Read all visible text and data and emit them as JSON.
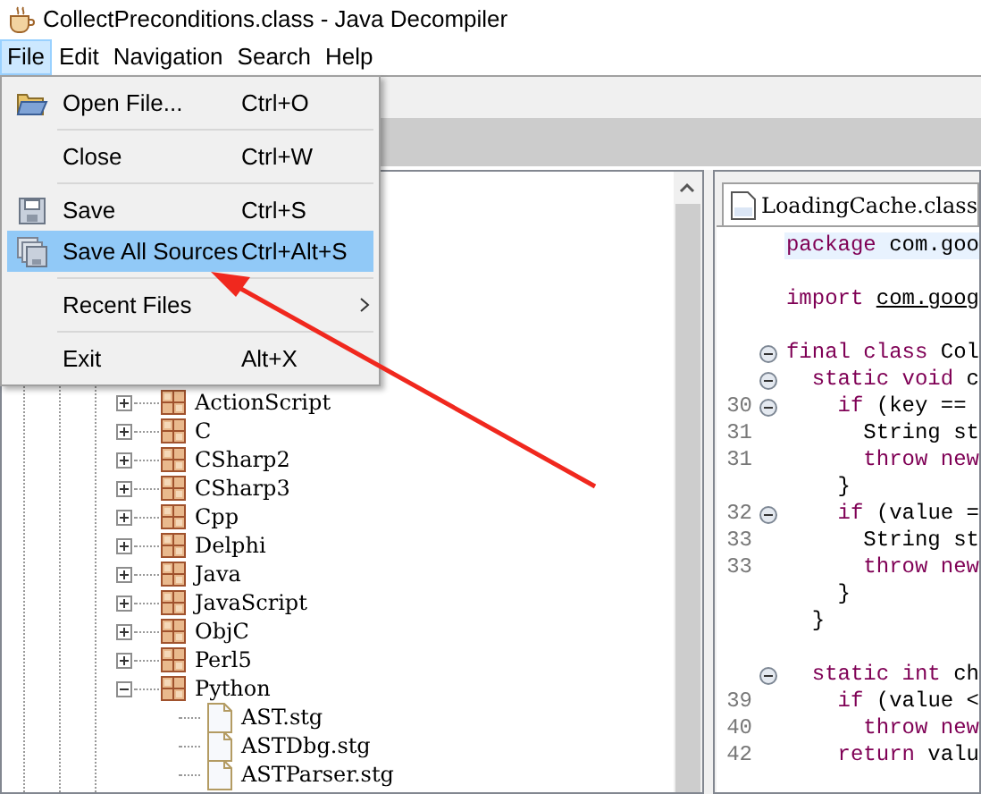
{
  "window": {
    "title": "CollectPreconditions.class - Java Decompiler"
  },
  "menubar": [
    {
      "label": "File",
      "selected": true
    },
    {
      "label": "Edit",
      "selected": false
    },
    {
      "label": "Navigation",
      "selected": false
    },
    {
      "label": "Search",
      "selected": false
    },
    {
      "label": "Help",
      "selected": false
    }
  ],
  "file_menu": [
    [
      {
        "label": "Open File...",
        "shortcut": "Ctrl+O",
        "kind": "open",
        "selected": false
      }
    ],
    [
      {
        "label": "Close",
        "shortcut": "Ctrl+W",
        "kind": "plain",
        "selected": false
      }
    ],
    [
      {
        "label": "Save",
        "shortcut": "Ctrl+S",
        "kind": "save",
        "selected": false
      },
      {
        "label": "Save All Sources",
        "shortcut": "Ctrl+Alt+S",
        "kind": "save-all",
        "selected": true
      }
    ],
    [
      {
        "label": "Recent Files",
        "kind": "submenu",
        "selected": false
      }
    ],
    [
      {
        "label": "Exit",
        "shortcut": "Alt+X",
        "kind": "plain",
        "selected": false
      }
    ]
  ],
  "tree": [
    {
      "label": "ActionScript",
      "kind": "folder",
      "expanded": false
    },
    {
      "label": "C",
      "kind": "folder",
      "expanded": false
    },
    {
      "label": "CSharp2",
      "kind": "folder",
      "expanded": false
    },
    {
      "label": "CSharp3",
      "kind": "folder",
      "expanded": false
    },
    {
      "label": "Cpp",
      "kind": "folder",
      "expanded": false
    },
    {
      "label": "Delphi",
      "kind": "folder",
      "expanded": false
    },
    {
      "label": "Java",
      "kind": "folder",
      "expanded": false
    },
    {
      "label": "JavaScript",
      "kind": "folder",
      "expanded": false
    },
    {
      "label": "ObjC",
      "kind": "folder",
      "expanded": false
    },
    {
      "label": "Perl5",
      "kind": "folder",
      "expanded": false
    },
    {
      "label": "Python",
      "kind": "folder",
      "expanded": true,
      "children": [
        {
          "label": "AST.stg",
          "kind": "file"
        },
        {
          "label": "ASTDbg.stg",
          "kind": "file"
        },
        {
          "label": "ASTParser.stg",
          "kind": "file"
        }
      ]
    }
  ],
  "editor": {
    "tab": {
      "label": "LoadingCache.class"
    },
    "lines": [
      {
        "tokens": [
          {
            "text": "package",
            "kind": "keyword"
          },
          {
            "text": " com.goo",
            "kind": "plain"
          }
        ],
        "current": true
      },
      {
        "blank_before": true,
        "tokens": [
          {
            "text": "import ",
            "kind": "keyword"
          },
          {
            "text": "com.goog",
            "kind": "link"
          }
        ]
      },
      {
        "blank_before": true,
        "fold": true,
        "tokens": [
          {
            "text": "final class",
            "kind": "keyword"
          },
          {
            "text": " Col",
            "kind": "plain"
          }
        ]
      },
      {
        "fold": true,
        "tokens": [
          {
            "text": "  static void",
            "kind": "keyword"
          },
          {
            "text": " c",
            "kind": "plain"
          }
        ]
      },
      {
        "number": "30",
        "fold": true,
        "tokens": [
          {
            "text": "    if",
            "kind": "keyword"
          },
          {
            "text": " (key ==",
            "kind": "plain"
          }
        ]
      },
      {
        "number": "31",
        "tokens": [
          {
            "text": "      String st",
            "kind": "plain"
          }
        ]
      },
      {
        "number": "31",
        "tokens": [
          {
            "text": "      throw new",
            "kind": "keyword"
          }
        ]
      },
      {
        "tokens": [
          {
            "text": "    }",
            "kind": "plain"
          }
        ]
      },
      {
        "number": "32",
        "fold": true,
        "tokens": [
          {
            "text": "    if",
            "kind": "keyword"
          },
          {
            "text": " (value =",
            "kind": "plain"
          }
        ]
      },
      {
        "number": "33",
        "tokens": [
          {
            "text": "      String st",
            "kind": "plain"
          }
        ]
      },
      {
        "number": "33",
        "tokens": [
          {
            "text": "      throw new",
            "kind": "keyword"
          }
        ]
      },
      {
        "tokens": [
          {
            "text": "    }",
            "kind": "plain"
          }
        ]
      },
      {
        "tokens": [
          {
            "text": "  }",
            "kind": "plain"
          }
        ]
      },
      {
        "blank_before": true,
        "fold": true,
        "tokens": [
          {
            "text": "  static int",
            "kind": "keyword"
          },
          {
            "text": " ch",
            "kind": "plain"
          }
        ]
      },
      {
        "number": "39",
        "tokens": [
          {
            "text": "    if",
            "kind": "keyword"
          },
          {
            "text": " (value <",
            "kind": "plain"
          }
        ]
      },
      {
        "number": "40",
        "tokens": [
          {
            "text": "      throw new",
            "kind": "keyword"
          }
        ]
      },
      {
        "number": "42",
        "tokens": [
          {
            "text": "    return",
            "kind": "keyword"
          },
          {
            "text": " valu",
            "kind": "plain"
          }
        ]
      }
    ]
  }
}
